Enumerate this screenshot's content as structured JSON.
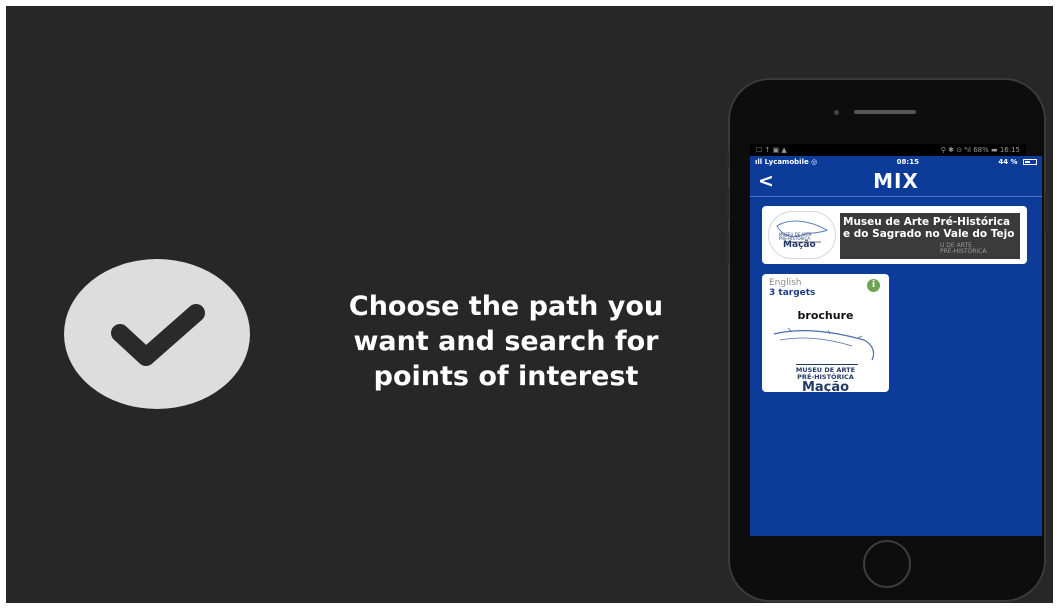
{
  "slide": {
    "headline": "Choose the path you\nwant and search for\npoints of interest"
  },
  "icons": {
    "check": "checkmark-icon"
  },
  "colors": {
    "slide_bg": "#272727",
    "screen_bg": "#0c3b9a",
    "circle": "#dddddd",
    "info_green": "#6fa352"
  },
  "android_status": {
    "left": "☐ ↑ ▣ ▲",
    "right": "⚲ ✱ ⊙ ⁴ıl 68% ▬ 16:15"
  },
  "ios_status": {
    "carrier": "Lycamobile",
    "time": "08:15",
    "battery": "44 %"
  },
  "nav": {
    "back": "<",
    "title": "MIX"
  },
  "museum": {
    "logo_text": "Mação",
    "logo_small": "MUSEU DE ARTE\nPRÉ-HISTÓRICA",
    "title": "Museu de Arte Pré-Histórica e do Sagrado no Vale do Tejo",
    "overlay": "U DE ARTE\nPRÉ-HISTÓRICA"
  },
  "path_card": {
    "language": "English",
    "targets": "3 targets",
    "info": "i",
    "name": "brochure",
    "art_line1": "MUSEU DE ARTE",
    "art_line2": "PRÉ-HISTÓRICA",
    "art_big": "Mação"
  }
}
